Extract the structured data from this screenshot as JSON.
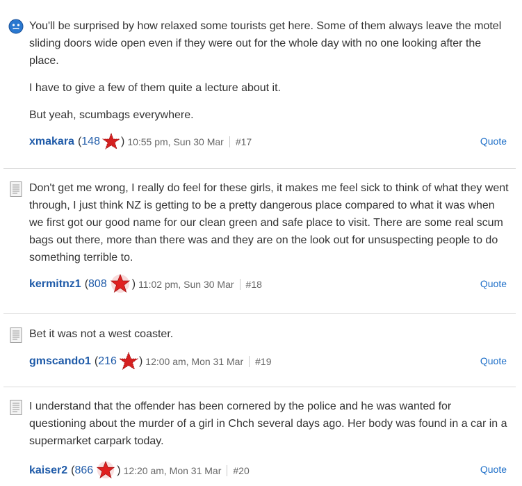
{
  "posts": [
    {
      "icon": "smiley-icon",
      "paragraphs": [
        "You'll be surprised by how relaxed some tourists get here. Some of them always leave the motel sliding doors wide open even if they were out for the whole day with no one looking after the place.",
        "I have to give a few of them quite a lecture about it.",
        "But yeah, scumbags everywhere."
      ],
      "username": "xmakara",
      "karma": "148",
      "time": "10:55 pm, Sun 30 Mar",
      "number": "#17",
      "quote_label": "Quote"
    },
    {
      "icon": "document-icon",
      "paragraphs": [
        "Don't get me wrong, I really do feel for these girls, it makes me feel sick to think of what they went through, I just think NZ is getting to be a pretty dangerous place compared to what it was when we first got our good name for our clean green and safe place to visit. There are some real scum bags out there, more than there was and they are on the look out for unsuspecting people to do something terrible to."
      ],
      "username": "kermitnz1",
      "karma": "808",
      "time": "11:02 pm, Sun 30 Mar",
      "number": "#18",
      "quote_label": "Quote"
    },
    {
      "icon": "document-icon",
      "paragraphs": [
        "Bet it was not a west coaster."
      ],
      "username": "gmscando1",
      "karma": "216",
      "time": "12:00 am, Mon 31 Mar",
      "number": "#19",
      "quote_label": "Quote"
    },
    {
      "icon": "document-icon",
      "paragraphs": [
        "I understand that the offender has been cornered by the police and he was wanted for questioning about the murder of a girl in Chch several days ago. Her body was found in a car in a supermarket carpark today."
      ],
      "username": "kaiser2",
      "karma": "866",
      "time": "12:20 am, Mon 31 Mar",
      "number": "#20",
      "quote_label": "Quote"
    }
  ],
  "colors": {
    "link": "#1e5aa8",
    "quote": "#1e6fc8",
    "star_red": "#d42020"
  }
}
